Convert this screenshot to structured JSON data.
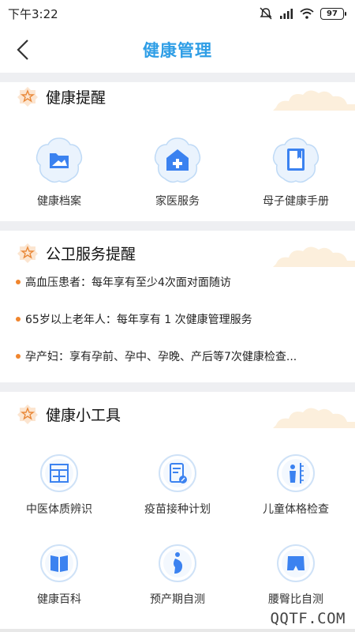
{
  "status_bar": {
    "time": "下午3:22",
    "battery": "97"
  },
  "nav": {
    "title": "健康管理"
  },
  "sections": {
    "reminders": {
      "title": "健康提醒",
      "items": [
        {
          "label": "健康档案",
          "icon": "folder-icon"
        },
        {
          "label": "家医服务",
          "icon": "home-plus-icon"
        },
        {
          "label": "母子健康手册",
          "icon": "handbook-icon"
        }
      ]
    },
    "public_health": {
      "title": "公卫服务提醒",
      "notices": [
        "高血压患者：每年享有至少4次面对面随访",
        "65岁以上老年人：每年享有 1 次健康管理服务",
        "孕产妇：享有孕前、孕中、孕晚、产后等7次健康检查..."
      ]
    },
    "tools": {
      "title": "健康小工具",
      "items": [
        {
          "label": "中医体质辨识",
          "icon": "tcm-icon"
        },
        {
          "label": "疫苗接种计划",
          "icon": "vaccine-plan-icon"
        },
        {
          "label": "儿童体格检查",
          "icon": "child-height-icon"
        },
        {
          "label": "健康百科",
          "icon": "encyclopedia-icon"
        },
        {
          "label": "预产期自测",
          "icon": "pregnancy-icon"
        },
        {
          "label": "腰臀比自测",
          "icon": "waist-hip-icon"
        }
      ]
    }
  },
  "watermark": "QQTF.COM"
}
